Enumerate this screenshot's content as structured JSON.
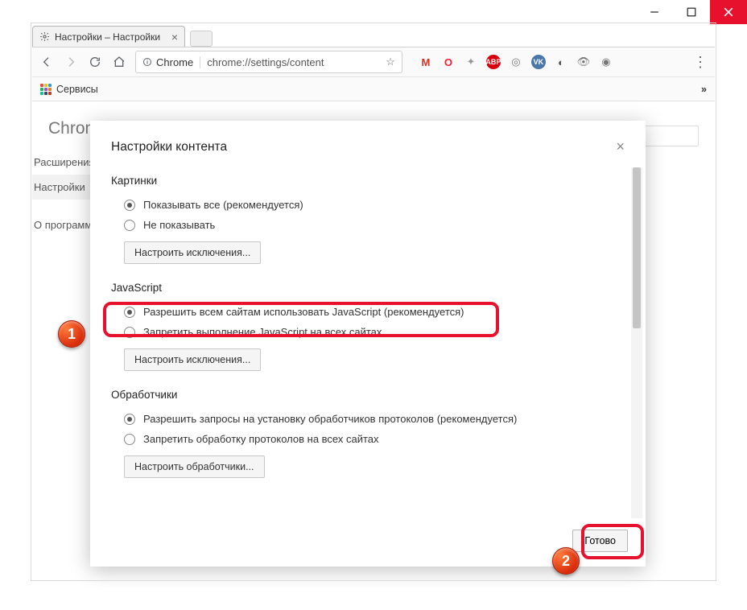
{
  "window": {
    "tab_title": "Настройки – Настройки"
  },
  "omnibox": {
    "origin_label": "Chrome",
    "url": "chrome://settings/content"
  },
  "bookmarks": {
    "services": "Сервисы"
  },
  "page": {
    "app_name": "Chrome",
    "sidebar": {
      "extensions": "Расширения",
      "settings": "Настройки",
      "about": "О программе"
    }
  },
  "dialog": {
    "title": "Настройки контента",
    "done": "Готово",
    "sections": {
      "images": {
        "title": "Картинки",
        "show_all": "Показывать все (рекомендуется)",
        "hide": "Не показывать",
        "manage": "Настроить исключения..."
      },
      "javascript": {
        "title": "JavaScript",
        "allow": "Разрешить всем сайтам использовать JavaScript (рекомендуется)",
        "block": "Запретить выполнение JavaScript на всех сайтах",
        "manage": "Настроить исключения..."
      },
      "handlers": {
        "title": "Обработчики",
        "allow": "Разрешить запросы на установку обработчиков протоколов (рекомендуется)",
        "block": "Запретить обработку протоколов на всех сайтах",
        "manage": "Настроить обработчики..."
      }
    }
  },
  "badges": {
    "one": "1",
    "two": "2"
  }
}
